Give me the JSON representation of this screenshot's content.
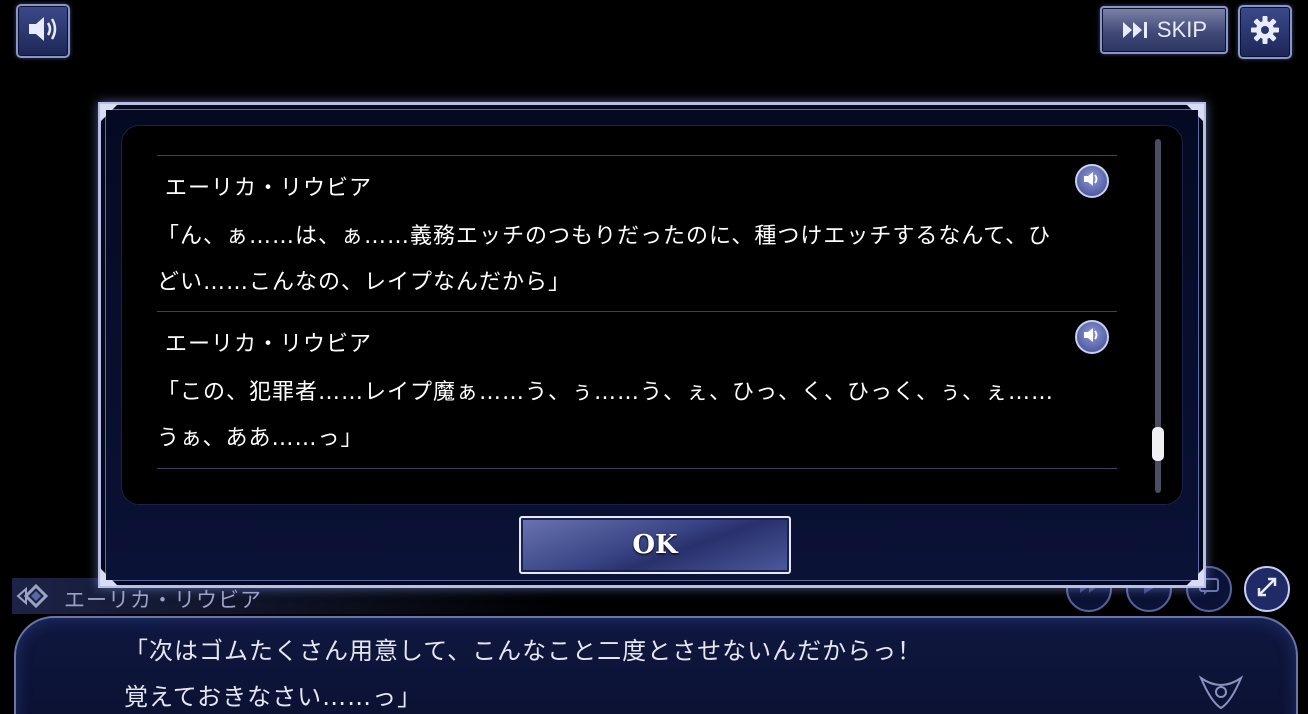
{
  "hud": {
    "skip_label": "SKIP",
    "sound_icon": "speaker-icon",
    "settings_icon": "gear-icon"
  },
  "background_message": {
    "speaker": "エーリカ・リウビア",
    "lines": [
      "「次はゴムたくさん用意して、こんなこと二度とさせないんだからっ！",
      "覚えておきなさい……っ」"
    ],
    "controls": [
      "fast-forward-icon",
      "auto-play-icon",
      "backlog-icon",
      "fullscreen-icon"
    ]
  },
  "backlog": {
    "entries": [
      {
        "speaker": "エーリカ・リウビア",
        "lines": [
          "「ん、ぁ……は、ぁ……義務エッチのつもりだったのに、種つけエッチするなんて、ひ",
          "どい……こんなの、レイプなんだから」"
        ]
      },
      {
        "speaker": "エーリカ・リウビア",
        "lines": [
          "「この、犯罪者……レイプ魔ぁ……う、ぅ……う、ぇ、ひっ、く、ひっく、ぅ、ぇ……",
          "うぁ、ああ……っ」"
        ]
      }
    ],
    "scroll_position": 0.9,
    "ok_label": "OK"
  },
  "colors": {
    "frame": "#b7bfe6",
    "button": "#3a4586",
    "panel": "#000000"
  }
}
